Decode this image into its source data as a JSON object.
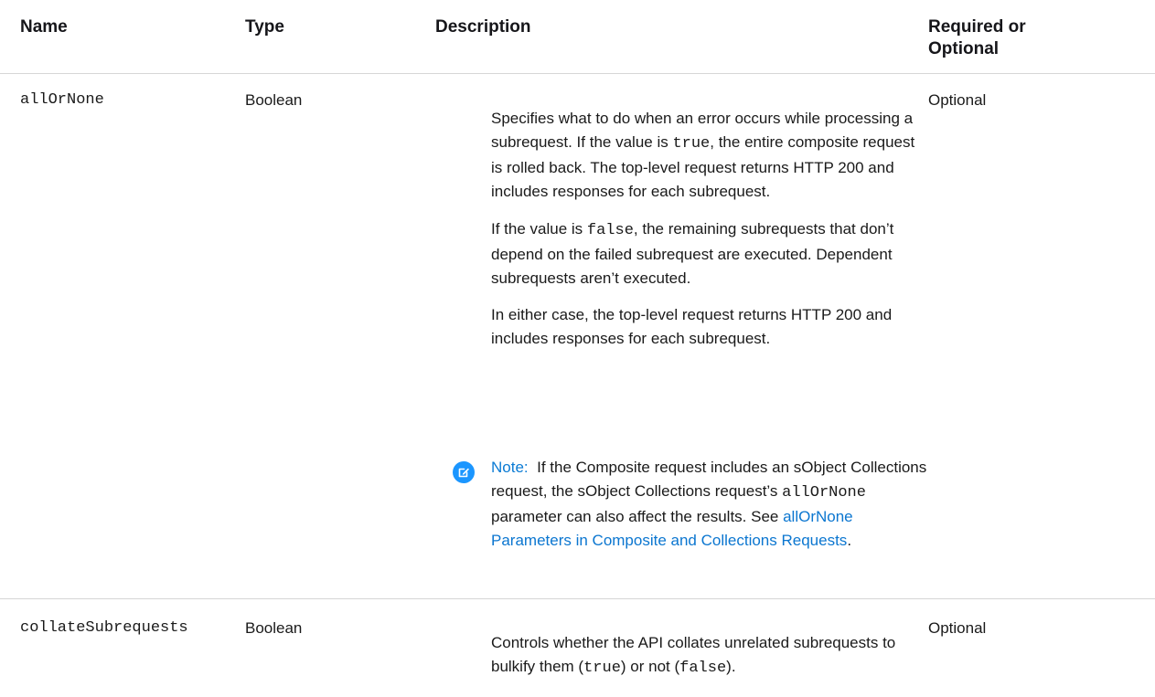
{
  "table": {
    "headers": {
      "name": "Name",
      "type": "Type",
      "description": "Description",
      "required_line1": "Required or",
      "required_line2": "Optional"
    },
    "rows": [
      {
        "name": "allOrNone",
        "type": "Boolean",
        "required": "Optional",
        "p1_a": "Specifies what to do when an error occurs while processing a subrequest. If the value is ",
        "p1_code": "true",
        "p1_b": ", the entire composite request is rolled back. The top-level request returns HTTP 200 and includes responses for each subrequest.",
        "p2_a": "If the value is ",
        "p2_code": "false",
        "p2_b": ", the remaining subrequests that don’t depend on the failed subrequest are executed. Dependent subrequests aren’t executed.",
        "p3": "In either case, the top-level request returns HTTP 200 and includes responses for each subrequest.",
        "note_label": "Note:",
        "note_a": "If the Composite request includes an sObject Collections request, the sObject Collections request’s ",
        "note_code": "allOrNone",
        "note_b": " parameter can also affect the results. See ",
        "note_link": "allOrNone Parameters in Composite and Collections Requests",
        "note_end": "."
      },
      {
        "name": "collateSubrequests",
        "type": "Boolean",
        "required": "Optional",
        "p1_a": "Controls whether the API collates unrelated subrequests to bulkify them (",
        "p1_code1": "true",
        "p1_mid": ") or not (",
        "p1_code2": "false",
        "p1_end": ")."
      }
    ]
  },
  "icons": {
    "note": "note-edit-icon"
  },
  "colors": {
    "note_icon": "#1b96ff",
    "link": "#0b76d0",
    "note_label": "#0b7bd4"
  }
}
